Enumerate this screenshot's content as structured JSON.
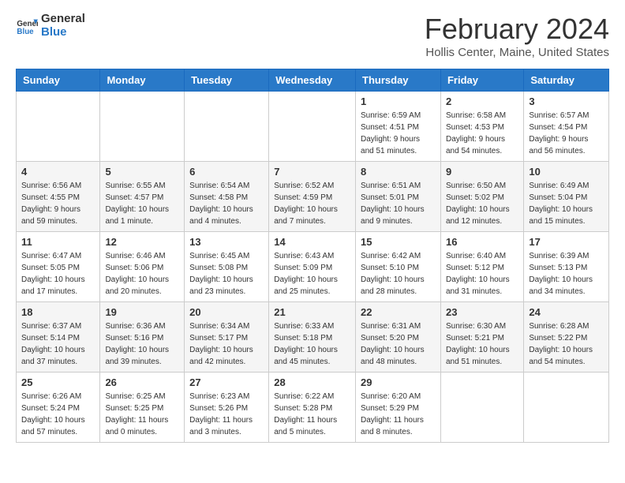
{
  "logo": {
    "line1": "General",
    "line2": "Blue"
  },
  "title": "February 2024",
  "subtitle": "Hollis Center, Maine, United States",
  "days_header": [
    "Sunday",
    "Monday",
    "Tuesday",
    "Wednesday",
    "Thursday",
    "Friday",
    "Saturday"
  ],
  "weeks": [
    [
      {
        "day": "",
        "info": ""
      },
      {
        "day": "",
        "info": ""
      },
      {
        "day": "",
        "info": ""
      },
      {
        "day": "",
        "info": ""
      },
      {
        "day": "1",
        "info": "Sunrise: 6:59 AM\nSunset: 4:51 PM\nDaylight: 9 hours\nand 51 minutes."
      },
      {
        "day": "2",
        "info": "Sunrise: 6:58 AM\nSunset: 4:53 PM\nDaylight: 9 hours\nand 54 minutes."
      },
      {
        "day": "3",
        "info": "Sunrise: 6:57 AM\nSunset: 4:54 PM\nDaylight: 9 hours\nand 56 minutes."
      }
    ],
    [
      {
        "day": "4",
        "info": "Sunrise: 6:56 AM\nSunset: 4:55 PM\nDaylight: 9 hours\nand 59 minutes."
      },
      {
        "day": "5",
        "info": "Sunrise: 6:55 AM\nSunset: 4:57 PM\nDaylight: 10 hours\nand 1 minute."
      },
      {
        "day": "6",
        "info": "Sunrise: 6:54 AM\nSunset: 4:58 PM\nDaylight: 10 hours\nand 4 minutes."
      },
      {
        "day": "7",
        "info": "Sunrise: 6:52 AM\nSunset: 4:59 PM\nDaylight: 10 hours\nand 7 minutes."
      },
      {
        "day": "8",
        "info": "Sunrise: 6:51 AM\nSunset: 5:01 PM\nDaylight: 10 hours\nand 9 minutes."
      },
      {
        "day": "9",
        "info": "Sunrise: 6:50 AM\nSunset: 5:02 PM\nDaylight: 10 hours\nand 12 minutes."
      },
      {
        "day": "10",
        "info": "Sunrise: 6:49 AM\nSunset: 5:04 PM\nDaylight: 10 hours\nand 15 minutes."
      }
    ],
    [
      {
        "day": "11",
        "info": "Sunrise: 6:47 AM\nSunset: 5:05 PM\nDaylight: 10 hours\nand 17 minutes."
      },
      {
        "day": "12",
        "info": "Sunrise: 6:46 AM\nSunset: 5:06 PM\nDaylight: 10 hours\nand 20 minutes."
      },
      {
        "day": "13",
        "info": "Sunrise: 6:45 AM\nSunset: 5:08 PM\nDaylight: 10 hours\nand 23 minutes."
      },
      {
        "day": "14",
        "info": "Sunrise: 6:43 AM\nSunset: 5:09 PM\nDaylight: 10 hours\nand 25 minutes."
      },
      {
        "day": "15",
        "info": "Sunrise: 6:42 AM\nSunset: 5:10 PM\nDaylight: 10 hours\nand 28 minutes."
      },
      {
        "day": "16",
        "info": "Sunrise: 6:40 AM\nSunset: 5:12 PM\nDaylight: 10 hours\nand 31 minutes."
      },
      {
        "day": "17",
        "info": "Sunrise: 6:39 AM\nSunset: 5:13 PM\nDaylight: 10 hours\nand 34 minutes."
      }
    ],
    [
      {
        "day": "18",
        "info": "Sunrise: 6:37 AM\nSunset: 5:14 PM\nDaylight: 10 hours\nand 37 minutes."
      },
      {
        "day": "19",
        "info": "Sunrise: 6:36 AM\nSunset: 5:16 PM\nDaylight: 10 hours\nand 39 minutes."
      },
      {
        "day": "20",
        "info": "Sunrise: 6:34 AM\nSunset: 5:17 PM\nDaylight: 10 hours\nand 42 minutes."
      },
      {
        "day": "21",
        "info": "Sunrise: 6:33 AM\nSunset: 5:18 PM\nDaylight: 10 hours\nand 45 minutes."
      },
      {
        "day": "22",
        "info": "Sunrise: 6:31 AM\nSunset: 5:20 PM\nDaylight: 10 hours\nand 48 minutes."
      },
      {
        "day": "23",
        "info": "Sunrise: 6:30 AM\nSunset: 5:21 PM\nDaylight: 10 hours\nand 51 minutes."
      },
      {
        "day": "24",
        "info": "Sunrise: 6:28 AM\nSunset: 5:22 PM\nDaylight: 10 hours\nand 54 minutes."
      }
    ],
    [
      {
        "day": "25",
        "info": "Sunrise: 6:26 AM\nSunset: 5:24 PM\nDaylight: 10 hours\nand 57 minutes."
      },
      {
        "day": "26",
        "info": "Sunrise: 6:25 AM\nSunset: 5:25 PM\nDaylight: 11 hours\nand 0 minutes."
      },
      {
        "day": "27",
        "info": "Sunrise: 6:23 AM\nSunset: 5:26 PM\nDaylight: 11 hours\nand 3 minutes."
      },
      {
        "day": "28",
        "info": "Sunrise: 6:22 AM\nSunset: 5:28 PM\nDaylight: 11 hours\nand 5 minutes."
      },
      {
        "day": "29",
        "info": "Sunrise: 6:20 AM\nSunset: 5:29 PM\nDaylight: 11 hours\nand 8 minutes."
      },
      {
        "day": "",
        "info": ""
      },
      {
        "day": "",
        "info": ""
      }
    ]
  ]
}
